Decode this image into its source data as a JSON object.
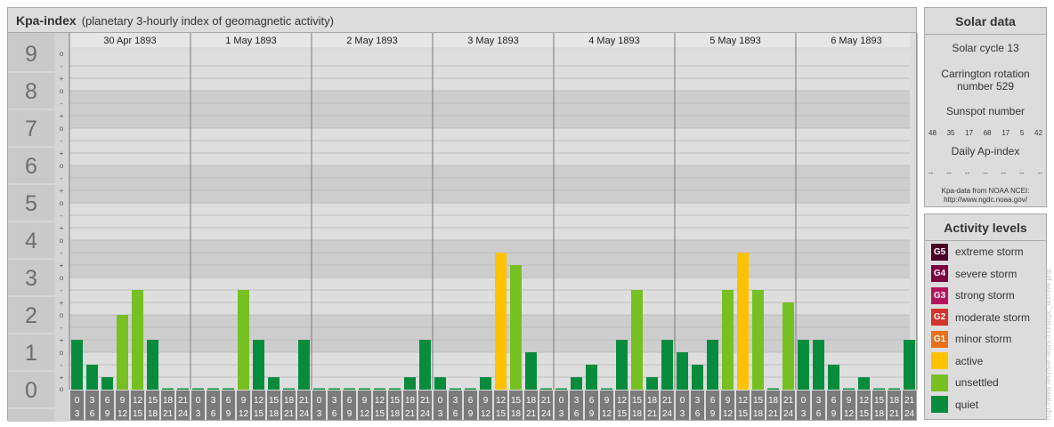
{
  "title": "Kpa-index",
  "subtitle": "(planetary 3-hourly index of geomagnetic activity)",
  "solar": {
    "title": "Solar data",
    "cycle": "Solar cycle 13",
    "carrington_line1": "Carrington rotation",
    "carrington_line2": "number 529",
    "sunspot_label": "Sunspot number",
    "sunspots": [
      "48",
      "35",
      "17",
      "68",
      "17",
      "5",
      "42"
    ],
    "ap_label": "Daily Ap-index",
    "ap_values": [
      "--",
      "--",
      "--",
      "--",
      "--",
      "--",
      "--"
    ],
    "source_line1": "Kpa-data from NOAA NCEI:",
    "source_line2": "http://www.ngdc.noaa.gov/"
  },
  "levels": {
    "title": "Activity levels",
    "items": [
      {
        "badge": "G5",
        "label": "extreme storm",
        "color": "#4b0026"
      },
      {
        "badge": "G4",
        "label": "severe storm",
        "color": "#7a0040"
      },
      {
        "badge": "G3",
        "label": "strong storm",
        "color": "#b5135d"
      },
      {
        "badge": "G2",
        "label": "moderate storm",
        "color": "#d2332c"
      },
      {
        "badge": "G1",
        "label": "minor storm",
        "color": "#e8721b"
      },
      {
        "badge": "",
        "label": "active",
        "color": "#fcc200"
      },
      {
        "badge": "",
        "label": "unsettled",
        "color": "#76c021"
      },
      {
        "badge": "",
        "label": "quiet",
        "color": "#078c3d"
      }
    ]
  },
  "watermark": "http://www.fleuriste-fleurs.fr/ursi/gic_archive.php",
  "chart_data": {
    "type": "bar",
    "title": "Kpa-index",
    "subtitle": "(planetary 3-hourly index of geomagnetic activity)",
    "ylim": [
      0,
      9
    ],
    "y_major_ticks": [
      "0",
      "1",
      "2",
      "3",
      "4",
      "5",
      "6",
      "7",
      "8",
      "9"
    ],
    "y_minor_ticks": [
      "+",
      "-",
      "o"
    ],
    "days": [
      "30 Apr 1893",
      "1 May 1893",
      "2 May 1893",
      "3 May 1893",
      "4 May 1893",
      "5 May 1893",
      "6 May 1893"
    ],
    "interval_starts": [
      "0",
      "3",
      "6",
      "9",
      "12",
      "15",
      "18",
      "21"
    ],
    "interval_ends": [
      "3",
      "6",
      "9",
      "12",
      "15",
      "18",
      "21",
      "24"
    ],
    "colors": {
      "quiet": "#078c3d",
      "unsettled": "#76c021",
      "active": "#fcc200"
    },
    "values": [
      1.333,
      0.667,
      0.333,
      2.0,
      2.667,
      1.333,
      0.0,
      0.0,
      0.0,
      0.0,
      0.0,
      2.667,
      1.333,
      0.333,
      0.0,
      1.333,
      0.0,
      0.0,
      0.0,
      0.0,
      0.0,
      0.0,
      0.333,
      1.333,
      0.333,
      0.0,
      0.0,
      0.333,
      3.667,
      3.333,
      1.0,
      0.0,
      0.0,
      0.333,
      0.667,
      0.0,
      1.333,
      2.667,
      0.333,
      1.333,
      1.0,
      0.667,
      1.333,
      2.667,
      3.667,
      2.667,
      0.0,
      2.333,
      1.333,
      1.333,
      0.667,
      0.0,
      0.333,
      0.0,
      0.0,
      1.333
    ]
  }
}
